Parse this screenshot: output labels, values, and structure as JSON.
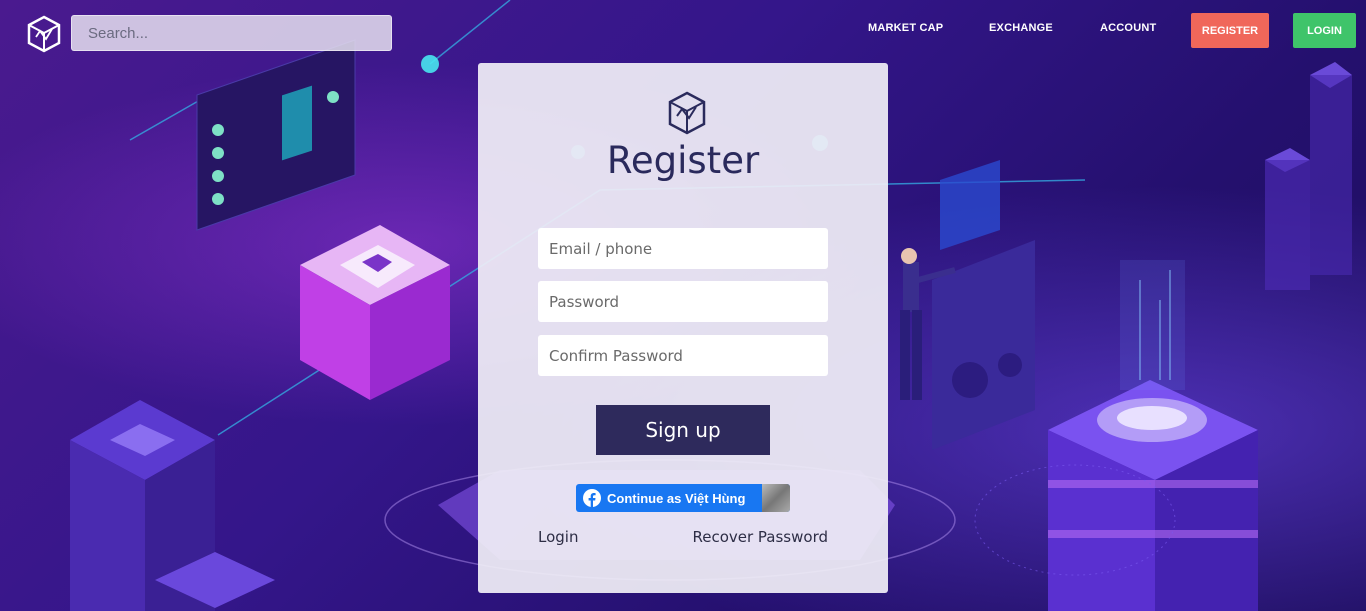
{
  "header": {
    "search_placeholder": "Search...",
    "nav": {
      "market_cap": "MARKET CAP",
      "exchange": "EXCHANGE",
      "account": "ACCOUNT",
      "register": "REGISTER",
      "login": "LOGIN"
    },
    "logo_icon": "cube-logo-icon"
  },
  "colors": {
    "register_button": "#f0675a",
    "login_button": "#3fc46a",
    "signup_button": "#2e2a5c",
    "facebook": "#1877f2",
    "title_text": "#2a2a5c"
  },
  "form": {
    "title": "Register",
    "email_placeholder": "Email / phone",
    "password_placeholder": "Password",
    "confirm_placeholder": "Confirm Password",
    "submit_label": "Sign up",
    "facebook_label": "Continue as Việt Hùng",
    "login_link": "Login",
    "recover_link": "Recover Password"
  }
}
